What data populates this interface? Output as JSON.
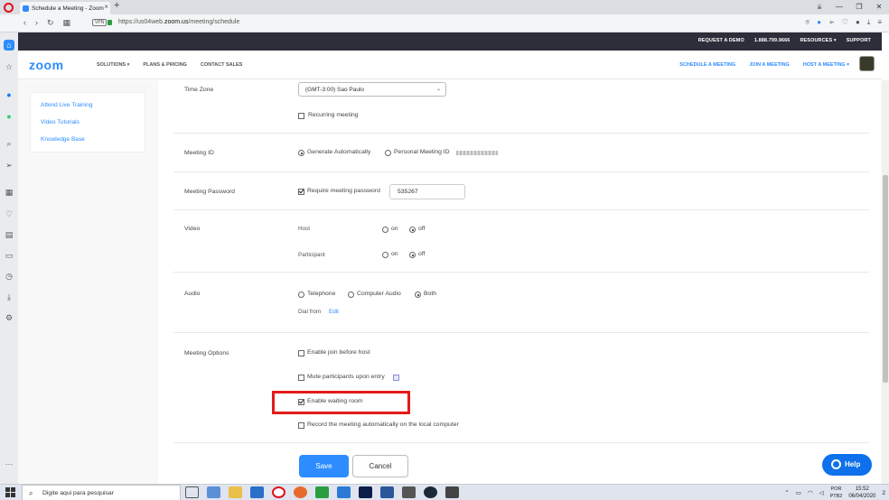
{
  "browser": {
    "tab_title": "Schedule a Meeting - Zoom",
    "new_tab": "+",
    "url_prefix": "https://us04web.",
    "url_domain": "zoom.us",
    "url_path": "/meeting/schedule",
    "vpn_label": "VPN",
    "window_controls": [
      "—",
      "❐",
      "✕"
    ]
  },
  "zoom_topnav": {
    "request_demo": "REQUEST A DEMO",
    "phone": "1.888.799.9666",
    "resources": "RESOURCES ▾",
    "support": "SUPPORT"
  },
  "zoom_header": {
    "logo": "zoom",
    "menu": [
      "SOLUTIONS ▾",
      "PLANS & PRICING",
      "CONTACT SALES"
    ],
    "schedule": "SCHEDULE A MEETING",
    "join": "JOIN A MEETING",
    "host": "HOST A MEETING ▾"
  },
  "left_panel": {
    "links": [
      "Attend Live Training",
      "Video Tutorials",
      "Knowledge Base"
    ]
  },
  "form": {
    "time_zone": {
      "label": "Time Zone",
      "value": "(GMT-3:00) Sao Paulo",
      "recurring": "Recurring meeting"
    },
    "meeting_id": {
      "label": "Meeting ID",
      "generate": "Generate Automatically",
      "personal": "Personal Meeting ID"
    },
    "password": {
      "label": "Meeting Password",
      "require": "Require meeting password",
      "value": "535267"
    },
    "video": {
      "label": "Video",
      "host": "Host",
      "participant": "Participant",
      "on": "on",
      "off": "off"
    },
    "audio": {
      "label": "Audio",
      "telephone": "Telephone",
      "computer": "Computer Audio",
      "both": "Both",
      "dial_from": "Dial from",
      "edit": "Edit"
    },
    "options": {
      "label": "Meeting Options",
      "join_before_host": "Enable join before host",
      "mute_on_entry": "Mute participants upon entry",
      "waiting_room": "Enable waiting room",
      "record_local": "Record the meeting automatically on the local computer"
    },
    "save": "Save",
    "cancel": "Cancel"
  },
  "help": "Help",
  "taskbar": {
    "search_placeholder": "Digite aqui para pesquisar",
    "lang": "POR",
    "layout": "PTB2",
    "time": "15:52",
    "date": "06/04/2020",
    "notifications": "2"
  },
  "colors": {
    "zoom_blue": "#2d8cff",
    "dark_nav": "#2d2e3a",
    "highlight_red": "#e31b1b",
    "help_blue": "#0e71eb"
  }
}
